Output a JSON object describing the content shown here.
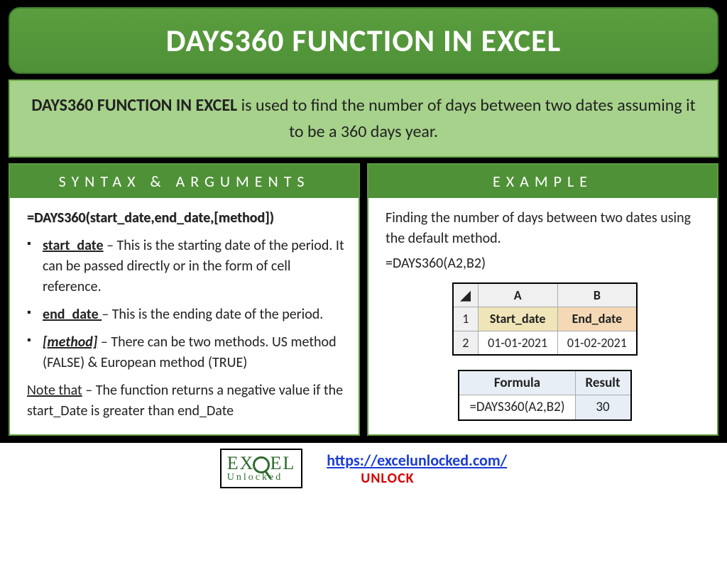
{
  "title": "DAYS360 FUNCTION IN EXCEL",
  "description": {
    "strong": "DAYS360 FUNCTION IN EXCEL",
    "rest": " is used to find the number of days between two dates assuming it to be a 360 days year."
  },
  "syntax": {
    "header": "SYNTAX & ARGUMENTS",
    "formula": "=DAYS360(start_date,end_date,[method])",
    "args": [
      {
        "name": "start_date",
        "italic": false,
        "desc": " – This is the starting date of the period. It can be passed directly or in the form of cell reference."
      },
      {
        "name": "end_date ",
        "italic": false,
        "desc": "– This is the ending date of the period."
      },
      {
        "name": "[method]",
        "italic": true,
        "desc": " – There can be two methods. US method (FALSE) & European method (TRUE)"
      }
    ],
    "note_label": "Note that",
    "note_text": " – The function returns a negative value if the start_Date is greater than end_Date"
  },
  "example": {
    "header": "EXAMPLE",
    "lead": "Finding the number of days between two dates using the default method.",
    "formula": "=DAYS360(A2,B2)",
    "sheet": {
      "col_a": "A",
      "col_b": "B",
      "row1": "1",
      "row2": "2",
      "hdr_a": "Start_date",
      "hdr_b": "End_date",
      "val_a": "01-01-2021",
      "val_b": "01-02-2021"
    },
    "result": {
      "hdr_formula": "Formula",
      "hdr_result": "Result",
      "formula_val": "=DAYS360(A2,B2)",
      "result_val": "30"
    }
  },
  "footer": {
    "logo_main": "EX  EL",
    "logo_sub": "Unlocked",
    "url": "https://excelunlocked.com/",
    "unlock": "UNLOCK"
  }
}
